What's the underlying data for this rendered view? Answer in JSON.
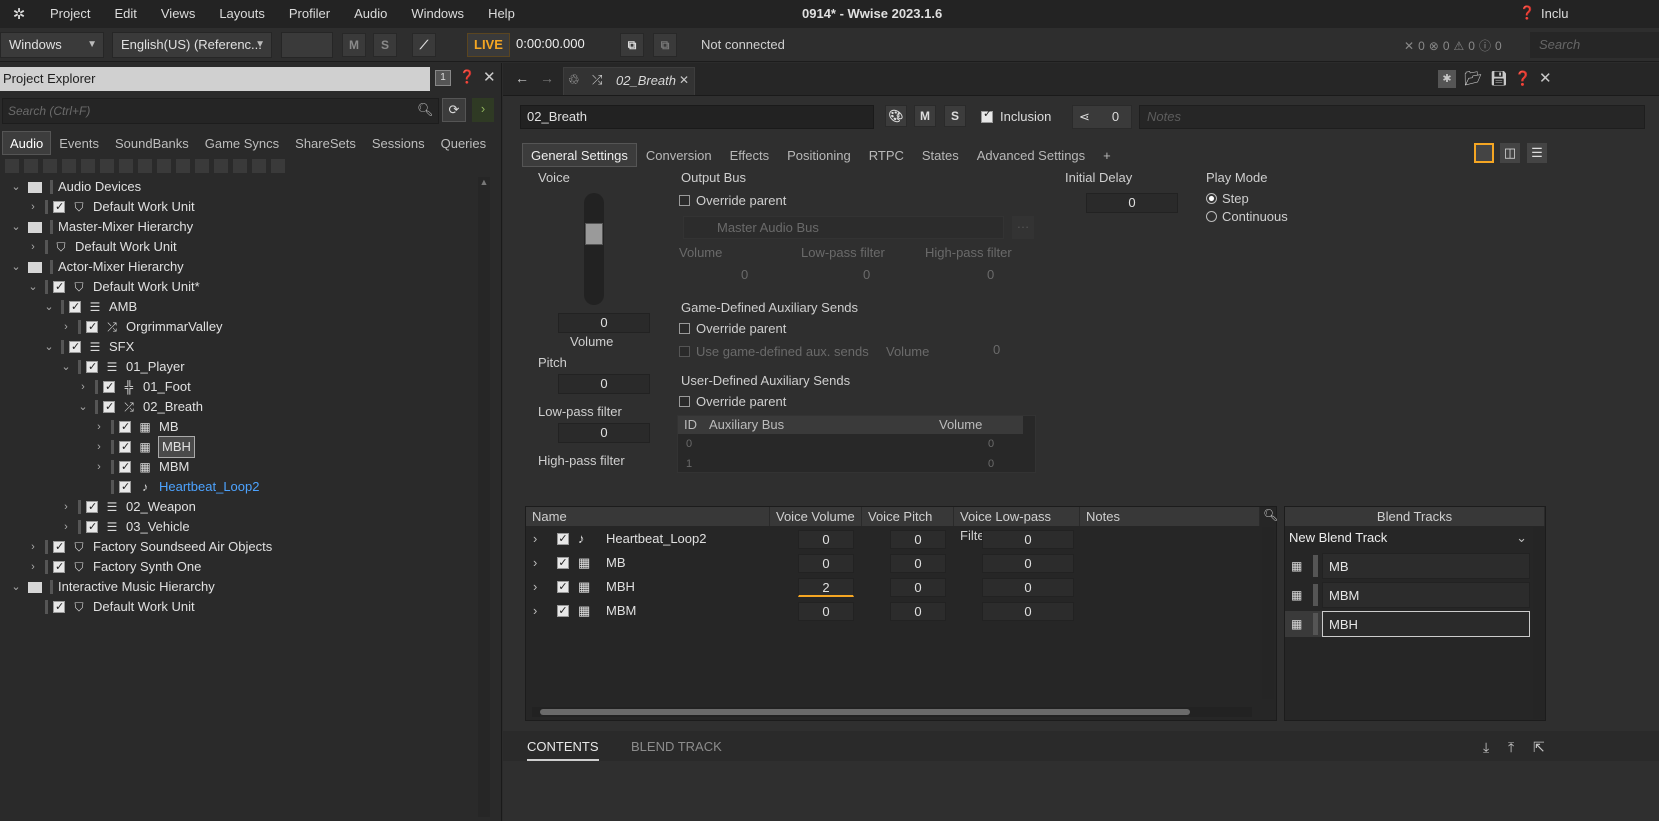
{
  "window": {
    "title": "0914* - Wwise 2023.1.6",
    "right_edge_text": "Inclu"
  },
  "menu": [
    "Project",
    "Edit",
    "Views",
    "Layouts",
    "Profiler",
    "Audio",
    "Windows",
    "Help"
  ],
  "toolbar": {
    "platform": "Windows",
    "language": "English(US) (Referenc...",
    "mute_label": "M",
    "solo_label": "S",
    "live_label": "LIVE",
    "time": "0:00:00.000",
    "connection": "Not connected",
    "counts": [
      "0",
      "0",
      "0",
      "0"
    ],
    "search_placeholder": "Search"
  },
  "project_explorer": {
    "title": "Project Explorer",
    "search_placeholder": "Search (Ctrl+F)",
    "tabs": [
      "Audio",
      "Events",
      "SoundBanks",
      "Game Syncs",
      "ShareSets",
      "Sessions",
      "Queries"
    ],
    "active_tab": "Audio",
    "tree": [
      {
        "label": "Audio Devices",
        "icon": "folder-icon"
      },
      {
        "label": "Default Work Unit",
        "icon": "work-unit-icon"
      },
      {
        "label": "Master-Mixer Hierarchy",
        "icon": "folder-icon"
      },
      {
        "label": "Default Work Unit",
        "icon": "work-unit-icon"
      },
      {
        "label": "Actor-Mixer Hierarchy",
        "icon": "folder-icon"
      },
      {
        "label": "Default Work Unit*",
        "icon": "work-unit-icon"
      },
      {
        "label": "AMB",
        "icon": "actor-mixer-icon"
      },
      {
        "label": "OrgrimmarValley",
        "icon": "random-container-icon"
      },
      {
        "label": "SFX",
        "icon": "actor-mixer-icon"
      },
      {
        "label": "01_Player",
        "icon": "actor-mixer-icon"
      },
      {
        "label": "01_Foot",
        "icon": "switch-container-icon"
      },
      {
        "label": "02_Breath",
        "icon": "random-container-icon"
      },
      {
        "label": "MB",
        "icon": "blend-container-icon"
      },
      {
        "label": "MBH",
        "icon": "blend-container-icon"
      },
      {
        "label": "MBM",
        "icon": "blend-container-icon"
      },
      {
        "label": "Heartbeat_Loop2",
        "icon": "sound-icon"
      },
      {
        "label": "02_Weapon",
        "icon": "actor-mixer-icon"
      },
      {
        "label": "03_Vehicle",
        "icon": "actor-mixer-icon"
      },
      {
        "label": "Factory Soundseed Air Objects",
        "icon": "work-unit-icon"
      },
      {
        "label": "Factory Synth One",
        "icon": "work-unit-icon"
      },
      {
        "label": "Interactive Music Hierarchy",
        "icon": "folder-icon"
      },
      {
        "label": "Default Work Unit",
        "icon": "work-unit-icon"
      }
    ]
  },
  "editor": {
    "tab_title": "02_Breath",
    "object_name": "02_Breath",
    "inclusion_label": "Inclusion",
    "share_count": "0",
    "notes_placeholder": "Notes",
    "property_tabs": [
      "General Settings",
      "Conversion",
      "Effects",
      "Positioning",
      "RTPC",
      "States",
      "Advanced Settings",
      "+"
    ],
    "active_tab": "General Settings",
    "voice": {
      "title": "Voice",
      "volume_value": "0",
      "volume_label": "Volume",
      "pitch_label": "Pitch",
      "pitch_value": "0",
      "lpf_label": "Low-pass filter",
      "lpf_value": "0",
      "hpf_label": "High-pass filter"
    },
    "output_bus": {
      "title": "Output Bus",
      "override_label": "Override parent",
      "bus_name": "Master Audio Bus",
      "volume_label": "Volume",
      "volume_value": "0",
      "lpf_label": "Low-pass filter",
      "lpf_value": "0",
      "hpf_label": "High-pass filter",
      "hpf_value": "0"
    },
    "game_aux": {
      "title": "Game-Defined Auxiliary Sends",
      "override_label": "Override parent",
      "use_label": "Use game-defined aux. sends",
      "volume_label": "Volume",
      "volume_value": "0"
    },
    "user_aux": {
      "title": "User-Defined Auxiliary Sends",
      "override_label": "Override parent",
      "columns": [
        "ID",
        "Auxiliary Bus",
        "Volume"
      ],
      "rows": [
        {
          "id": "0",
          "volume": "0"
        },
        {
          "id": "1",
          "volume": "0"
        }
      ]
    },
    "initial_delay": {
      "title": "Initial Delay",
      "value": "0"
    },
    "play_mode": {
      "title": "Play Mode",
      "options": [
        "Step",
        "Continuous"
      ],
      "selected": "Step"
    }
  },
  "contents": {
    "columns": [
      "Name",
      "Voice Volume",
      "Voice Pitch",
      "Voice Low-pass Filter",
      "Notes"
    ],
    "rows": [
      {
        "name": "Heartbeat_Loop2",
        "icon": "sound-icon",
        "volume": "0",
        "pitch": "0",
        "lpf": "0"
      },
      {
        "name": "MB",
        "icon": "blend-container-icon",
        "volume": "0",
        "pitch": "0",
        "lpf": "0"
      },
      {
        "name": "MBH",
        "icon": "blend-container-icon",
        "volume": "2",
        "pitch": "0",
        "lpf": "0"
      },
      {
        "name": "MBM",
        "icon": "blend-container-icon",
        "volume": "0",
        "pitch": "0",
        "lpf": "0"
      }
    ]
  },
  "blend_tracks": {
    "title": "Blend Tracks",
    "new_label": "New Blend Track",
    "items": [
      "MB",
      "MBM",
      "MBH"
    ]
  },
  "bottom_tabs": [
    "CONTENTS",
    "BLEND TRACK"
  ],
  "colors": {
    "accent": "#f5a623",
    "link": "#4da3ff",
    "selected_tab": "#3c3c3c"
  }
}
